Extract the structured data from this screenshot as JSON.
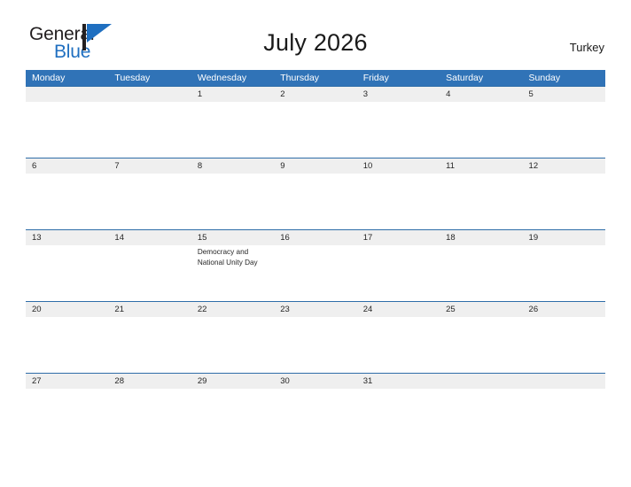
{
  "brand": {
    "name_part1": "General",
    "name_part2": "Blue",
    "logo_icon": "flag-triangle-icon",
    "color_dark": "#231f20",
    "color_blue": "#1f6fc0"
  },
  "header": {
    "title": "July 2026",
    "region": "Turkey",
    "header_bg": "#3073b7",
    "row_strip_bg": "#efefef",
    "divider_color": "#2e6da8"
  },
  "weekdays": [
    "Monday",
    "Tuesday",
    "Wednesday",
    "Thursday",
    "Friday",
    "Saturday",
    "Sunday"
  ],
  "weeks": [
    {
      "dates": [
        "",
        "",
        "1",
        "2",
        "3",
        "4",
        "5"
      ],
      "events": [
        "",
        "",
        "",
        "",
        "",
        "",
        ""
      ]
    },
    {
      "dates": [
        "6",
        "7",
        "8",
        "9",
        "10",
        "11",
        "12"
      ],
      "events": [
        "",
        "",
        "",
        "",
        "",
        "",
        ""
      ]
    },
    {
      "dates": [
        "13",
        "14",
        "15",
        "16",
        "17",
        "18",
        "19"
      ],
      "events": [
        "",
        "",
        "Democracy and National Unity Day",
        "",
        "",
        "",
        ""
      ]
    },
    {
      "dates": [
        "20",
        "21",
        "22",
        "23",
        "24",
        "25",
        "26"
      ],
      "events": [
        "",
        "",
        "",
        "",
        "",
        "",
        ""
      ]
    },
    {
      "dates": [
        "27",
        "28",
        "29",
        "30",
        "31",
        "",
        ""
      ],
      "events": [
        "",
        "",
        "",
        "",
        "",
        "",
        ""
      ]
    }
  ]
}
